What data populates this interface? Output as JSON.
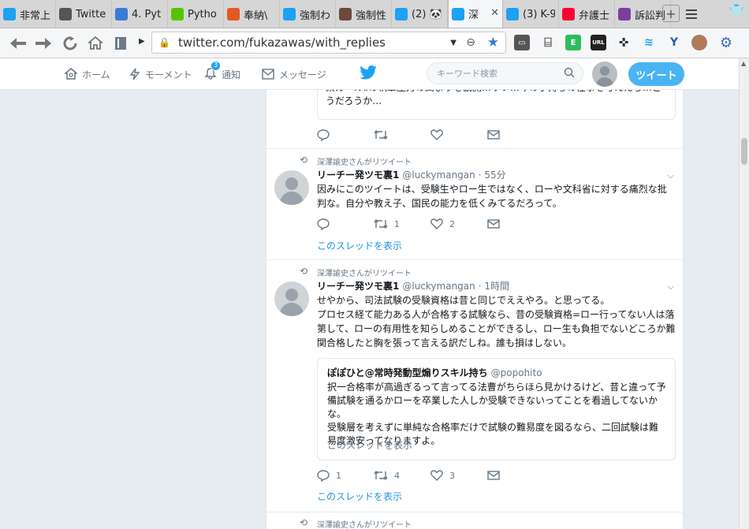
{
  "browser": {
    "tabs": [
      {
        "title": "非常上",
        "icon": "twitter-t-icon",
        "color": "#1da1f2"
      },
      {
        "title": "Twitte",
        "icon": "globe-icon",
        "color": "#555555"
      },
      {
        "title": "4. Pyt",
        "icon": "python-doc-icon",
        "color": "#3a7bd5"
      },
      {
        "title": "Pytho",
        "icon": "qiita-icon",
        "color": "#55c500"
      },
      {
        "title": "奉納\\",
        "icon": "fire-icon",
        "color": "#e05a24"
      },
      {
        "title": "強制わ",
        "icon": "twitter-bird-icon",
        "color": "#1da1f2"
      },
      {
        "title": "強制性",
        "icon": "photo-avatar-icon",
        "color": "#6b4a3a"
      },
      {
        "title": "(2) 🐼",
        "icon": "twitter-bird-icon",
        "color": "#1da1f2"
      },
      {
        "title": "深",
        "icon": "twitter-bird-icon",
        "color": "#1da1f2",
        "active": true
      },
      {
        "title": "(3) K-9",
        "icon": "twitter-bird-icon",
        "color": "#1da1f2"
      },
      {
        "title": "弁護士",
        "icon": "yahoo-icon",
        "color": "#ff0033"
      },
      {
        "title": "訴訟判",
        "icon": "law-icon",
        "color": "#7b3fa0"
      }
    ],
    "url": "twitter.com/fukazawas/with_replies"
  },
  "twitter": {
    "nav": {
      "home": "ホーム",
      "moments": "モーメント",
      "notifications": "通知",
      "notifications_badge": "3",
      "messages": "メッセージ"
    },
    "search_placeholder": "キーワード検索",
    "tweet_button": "ツイート"
  },
  "timeline": {
    "partial_tweet": {
      "text": "某ガールⅡの執筆圧力の高まりを観測…ウソ…今の手持ちの仕事を考えたら…どうだろうか…"
    },
    "tweets": [
      {
        "retweeted_by": "深澤諭史さんがリツイート",
        "name": "リーチー発ツモ裏1",
        "handle": "@luckymangan",
        "time": "· 55分",
        "text": "因みにこのツイートは、受験生やロー生ではなく、ローや文科省に対する痛烈な批判な。自分や教え子、国民の能力を低くみてるだろって。",
        "reply_count": "",
        "retweet_count": "1",
        "like_count": "2",
        "show_thread": "このスレッドを表示"
      },
      {
        "retweeted_by": "深澤諭史さんがリツイート",
        "name": "リーチー発ツモ裏1",
        "handle": "@luckymangan",
        "time": "· 1時間",
        "text": "せやから、司法試験の受験資格は昔と同じでええやろ。と思ってる。\nプロセス経て能力ある人が合格する試験なら、昔の受験資格=ロー行ってない人は落第して、ローの有用性を知らしめることができるし、ロー生も負担でないどころか難関合格したと胸を張って言える訳だしね。誰も損はしない。",
        "quote": {
          "name": "ぽぽひと@常時発動型煽りスキル持ち",
          "handle": "@popohito",
          "text": "択一合格率が高過ぎるって言ってる法曹がちらほら見かけるけど、昔と違って予備試験を通るかローを卒業した人しか受験できないってことを看過してないかな。\n受験層を考えずに単純な合格率だけで試験の難易度を図るなら、二回試験は難易度激安ってなりますよ。",
          "show_thread": "このスレッドを表示"
        },
        "reply_count": "1",
        "retweet_count": "4",
        "like_count": "3",
        "show_thread": "このスレッドを表示"
      }
    ],
    "next_retweet_label": "深澤諭史さんがリツイート"
  }
}
